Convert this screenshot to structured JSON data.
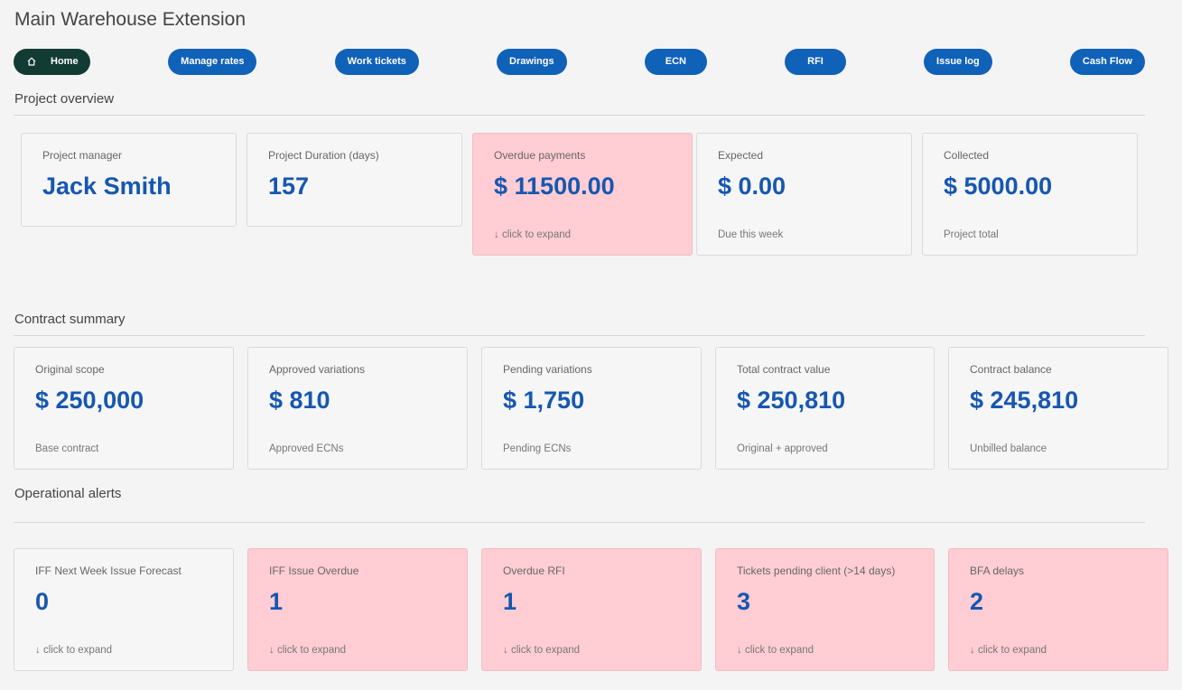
{
  "page": {
    "title": "Main Warehouse Extension"
  },
  "nav": {
    "home": "Home",
    "manage_rates": "Manage rates",
    "work_tickets": "Work tickets",
    "drawings": "Drawings",
    "ecn": "ECN",
    "rfi": "RFI",
    "issue_log": "Issue log",
    "cash_flow": "Cash Flow"
  },
  "overview": {
    "title": "Project overview",
    "manager": {
      "label": "Project manager",
      "value": "Jack Smith"
    },
    "duration": {
      "label": "Project Duration (days)",
      "value": "157"
    },
    "overdue": {
      "label": "Overdue payments",
      "value": "$ 11500.00",
      "sub": "↓ click to expand"
    },
    "expected": {
      "label": "Expected",
      "value": "$ 0.00",
      "sub": "Due this week"
    },
    "collected": {
      "label": "Collected",
      "value": "$ 5000.00",
      "sub": "Project total"
    }
  },
  "contract": {
    "title": "Contract summary",
    "original": {
      "label": "Original scope",
      "value": "$ 250,000",
      "sub": "Base contract"
    },
    "approved": {
      "label": "Approved variations",
      "value": "$ 810",
      "sub": "Approved ECNs"
    },
    "pending": {
      "label": "Pending variations",
      "value": "$ 1,750",
      "sub": "Pending ECNs"
    },
    "total": {
      "label": "Total contract value",
      "value": "$ 250,810",
      "sub": "Original + approved"
    },
    "balance": {
      "label": "Contract balance",
      "value": "$ 245,810",
      "sub": "Unbilled balance"
    }
  },
  "alerts": {
    "title": "Operational alerts",
    "iff_forecast": {
      "label": "IFF Next Week Issue Forecast",
      "value": "0",
      "sub": "↓ click to expand"
    },
    "iff_overdue": {
      "label": "IFF Issue Overdue",
      "value": "1",
      "sub": "↓ click to expand"
    },
    "overdue_rfi": {
      "label": "Overdue RFI",
      "value": "1",
      "sub": "↓ click to expand"
    },
    "tickets_pending": {
      "label": "Tickets pending client (>14 days)",
      "value": "3",
      "sub": "↓ click to expand"
    },
    "bfa_delays": {
      "label": "BFA delays",
      "value": "2",
      "sub": "↓ click to expand"
    }
  },
  "colors": {
    "accent": "#1061b8",
    "home": "#123c33",
    "alert_bg": "#ffcdd3",
    "value": "#1657b0"
  },
  "icons": {
    "home": "home-icon"
  }
}
